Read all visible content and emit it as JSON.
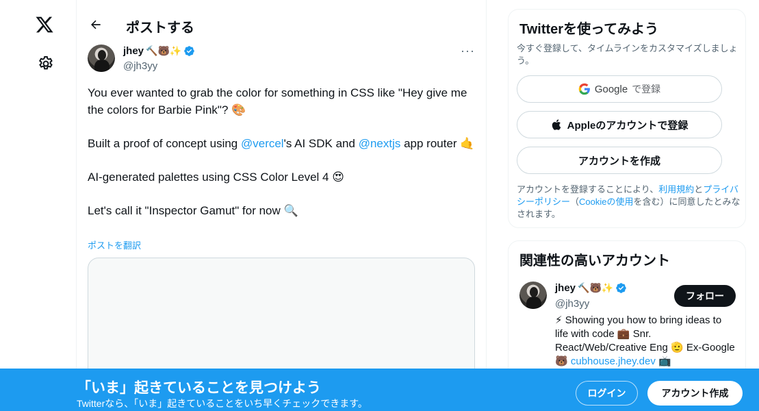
{
  "nav": {
    "logo_icon": "x-logo-icon",
    "settings_icon": "gear-icon"
  },
  "header": {
    "title": "ポストする"
  },
  "post": {
    "author_name": "jhey",
    "author_emojis": "🔨🐻✨",
    "author_handle": "@jh3yy",
    "more_label": "···",
    "paragraph1": "You ever wanted to grab the color for something in CSS like \"Hey give me the colors for Barbie Pink\"? 🎨",
    "paragraph2_before": "Built a proof of concept using ",
    "mention1": "@vercel",
    "paragraph2_middle": "'s AI SDK and ",
    "mention2": "@nextjs",
    "paragraph2_after": " app router 🤙",
    "paragraph3": "AI-generated palettes using CSS Color Level 4 😍",
    "paragraph4": "Let's call it \"Inspector Gamut\" for now 🔍",
    "translate_label": "ポストを翻訳"
  },
  "signup_card": {
    "title": "Twitterを使ってみよう",
    "subtitle": "今すぐ登録して、タイムラインをカスタマイズしましょう。",
    "google_brand": "Google",
    "google_label": "で登録",
    "apple_label": "Appleのアカウントで登録",
    "create_label": "アカウントを作成",
    "legal_1": "アカウントを登録することにより、",
    "terms_link": "利用規約",
    "legal_2": "と",
    "privacy_link": "プライバシーポリシー",
    "legal_3": "（",
    "cookie_link": "Cookieの使用",
    "legal_4": "を含む）に同意したとみなされます。"
  },
  "related_card": {
    "title": "関連性の高いアカウント",
    "name": "jhey",
    "emojis": "🔨🐻✨",
    "handle": "@jh3yy",
    "follow_label": "フォロー",
    "bio_text": "⚡ Showing you how to bring ideas to life with code 💼 Snr. React/Web/Creative Eng 🫡 Ex-Google 🐻 ",
    "bio_link": "cubhouse.jhey.dev",
    "bio_end": " 📺"
  },
  "banner": {
    "title": "「いま」起きていることを見つけよう",
    "subtitle": "Twitterなら、「いま」起きていることをいち早くチェックできます。",
    "login_label": "ログイン",
    "signup_label": "アカウント作成"
  },
  "colors": {
    "accent": "#1d9bf0",
    "text": "#0f1419",
    "muted": "#536471",
    "border": "#eff3f4"
  }
}
